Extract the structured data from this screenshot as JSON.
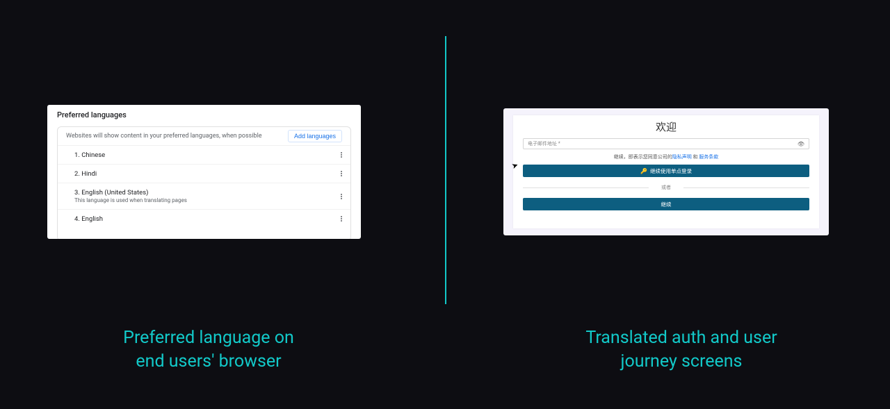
{
  "captions": {
    "left_line1": "Preferred language on",
    "left_line2": "end users' browser",
    "right_line1": "Translated auth and user",
    "right_line2": "journey screens"
  },
  "browser_settings": {
    "section_title": "Preferred languages",
    "description": "Websites will show content in your preferred languages, when possible",
    "add_button": "Add languages",
    "languages": [
      {
        "index": "1.",
        "name": "Chinese"
      },
      {
        "index": "2.",
        "name": "Hindi"
      },
      {
        "index": "3.",
        "name": "English (United States)",
        "sub": "This language is used when translating pages"
      },
      {
        "index": "4.",
        "name": "English"
      }
    ]
  },
  "auth_screen": {
    "title": "欢迎",
    "input_placeholder": "电子邮件地址 *",
    "terms_prefix": "继续，即表示您同意公司的",
    "terms_link1": "隐私声明",
    "terms_join": " 和 ",
    "terms_link2": "服务条款",
    "sso_button": "继续使用单点登录",
    "or_text": "或者",
    "continue_button": "继续"
  }
}
